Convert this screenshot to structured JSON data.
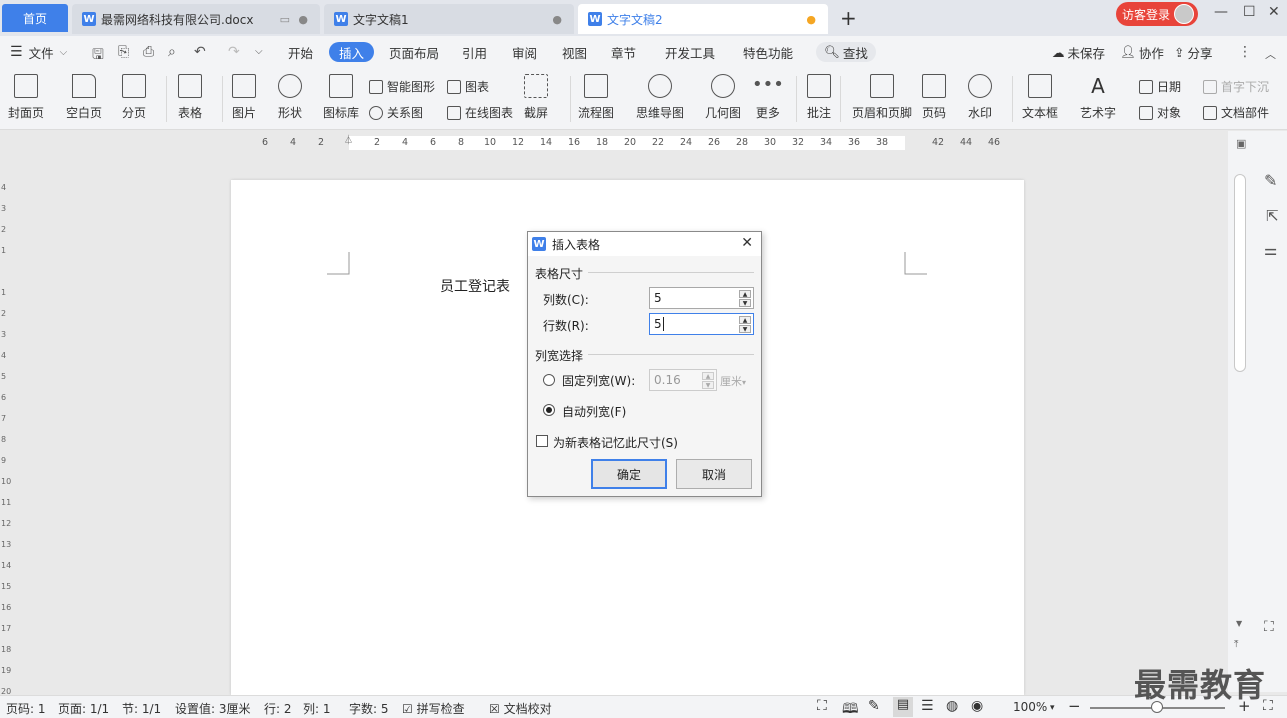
{
  "tabs": {
    "home": "首页",
    "doc1": "最需网络科技有限公司.docx",
    "doc2": "文字文稿1",
    "doc3": "文字文稿2",
    "new_tab": "+",
    "login": "访客登录"
  },
  "menu": {
    "file": "文件",
    "items": [
      "开始",
      "插入",
      "页面布局",
      "引用",
      "审阅",
      "视图",
      "章节",
      "开发工具",
      "特色功能"
    ],
    "active": "插入",
    "search": "查找",
    "unsaved": "未保存",
    "collab": "协作",
    "share": "分享"
  },
  "ribbon": {
    "cover": "封面页",
    "blank": "空白页",
    "pagebreak": "分页",
    "table": "表格",
    "picture": "图片",
    "shape": "形状",
    "iconlib": "图标库",
    "smartart": "智能图形",
    "chart": "图表",
    "relation": "关系图",
    "online_chart": "在线图表",
    "screenshot": "截屏",
    "flowchart": "流程图",
    "mindmap": "思维导图",
    "geometry": "几何图",
    "more": "更多",
    "comment": "批注",
    "header_footer": "页眉和页脚",
    "page_num": "页码",
    "watermark": "水印",
    "textbox": "文本框",
    "wordart": "艺术字",
    "date": "日期",
    "dropcap": "首字下沉",
    "object": "对象",
    "docparts": "文档部件"
  },
  "ruler": {
    "numbers": [
      "6",
      "4",
      "2",
      "",
      "2",
      "4",
      "6",
      "8",
      "10",
      "12",
      "14",
      "16",
      "18",
      "20",
      "22",
      "24",
      "26",
      "28",
      "30",
      "32",
      "34",
      "36",
      "38",
      "",
      "42",
      "44",
      "46"
    ]
  },
  "vruler": [
    "4",
    "3",
    "2",
    "1",
    "",
    "1",
    "2",
    "3",
    "4",
    "5",
    "6",
    "7",
    "8",
    "9",
    "10",
    "11",
    "12",
    "13",
    "14",
    "15",
    "16",
    "17",
    "18",
    "19",
    "20"
  ],
  "document": {
    "text": "员工登记表"
  },
  "dialog": {
    "title": "插入表格",
    "section_size": "表格尺寸",
    "cols_label": "列数(C):",
    "cols_value": "5",
    "rows_label": "行数(R):",
    "rows_value": "5",
    "section_width": "列宽选择",
    "fixed_label": "固定列宽(W):",
    "fixed_value": "0.16",
    "fixed_unit": "厘米",
    "auto_label": "自动列宽(F)",
    "auto_selected": true,
    "remember_label": "为新表格记忆此尺寸(S)",
    "ok": "确定",
    "cancel": "取消"
  },
  "status": {
    "page_code": "页码: 1",
    "page": "页面: 1/1",
    "section": "节: 1/1",
    "setting": "设置值: 3厘米",
    "row": "行: 2",
    "col": "列: 1",
    "words": "字数: 5",
    "spell": "拼写检查",
    "proof": "文档校对",
    "zoom": "100%"
  },
  "watermark": "最需教育",
  "colors": {
    "accent": "#3f80e9",
    "login": "#e8443a",
    "unsaved_dot": "#f5a623"
  }
}
